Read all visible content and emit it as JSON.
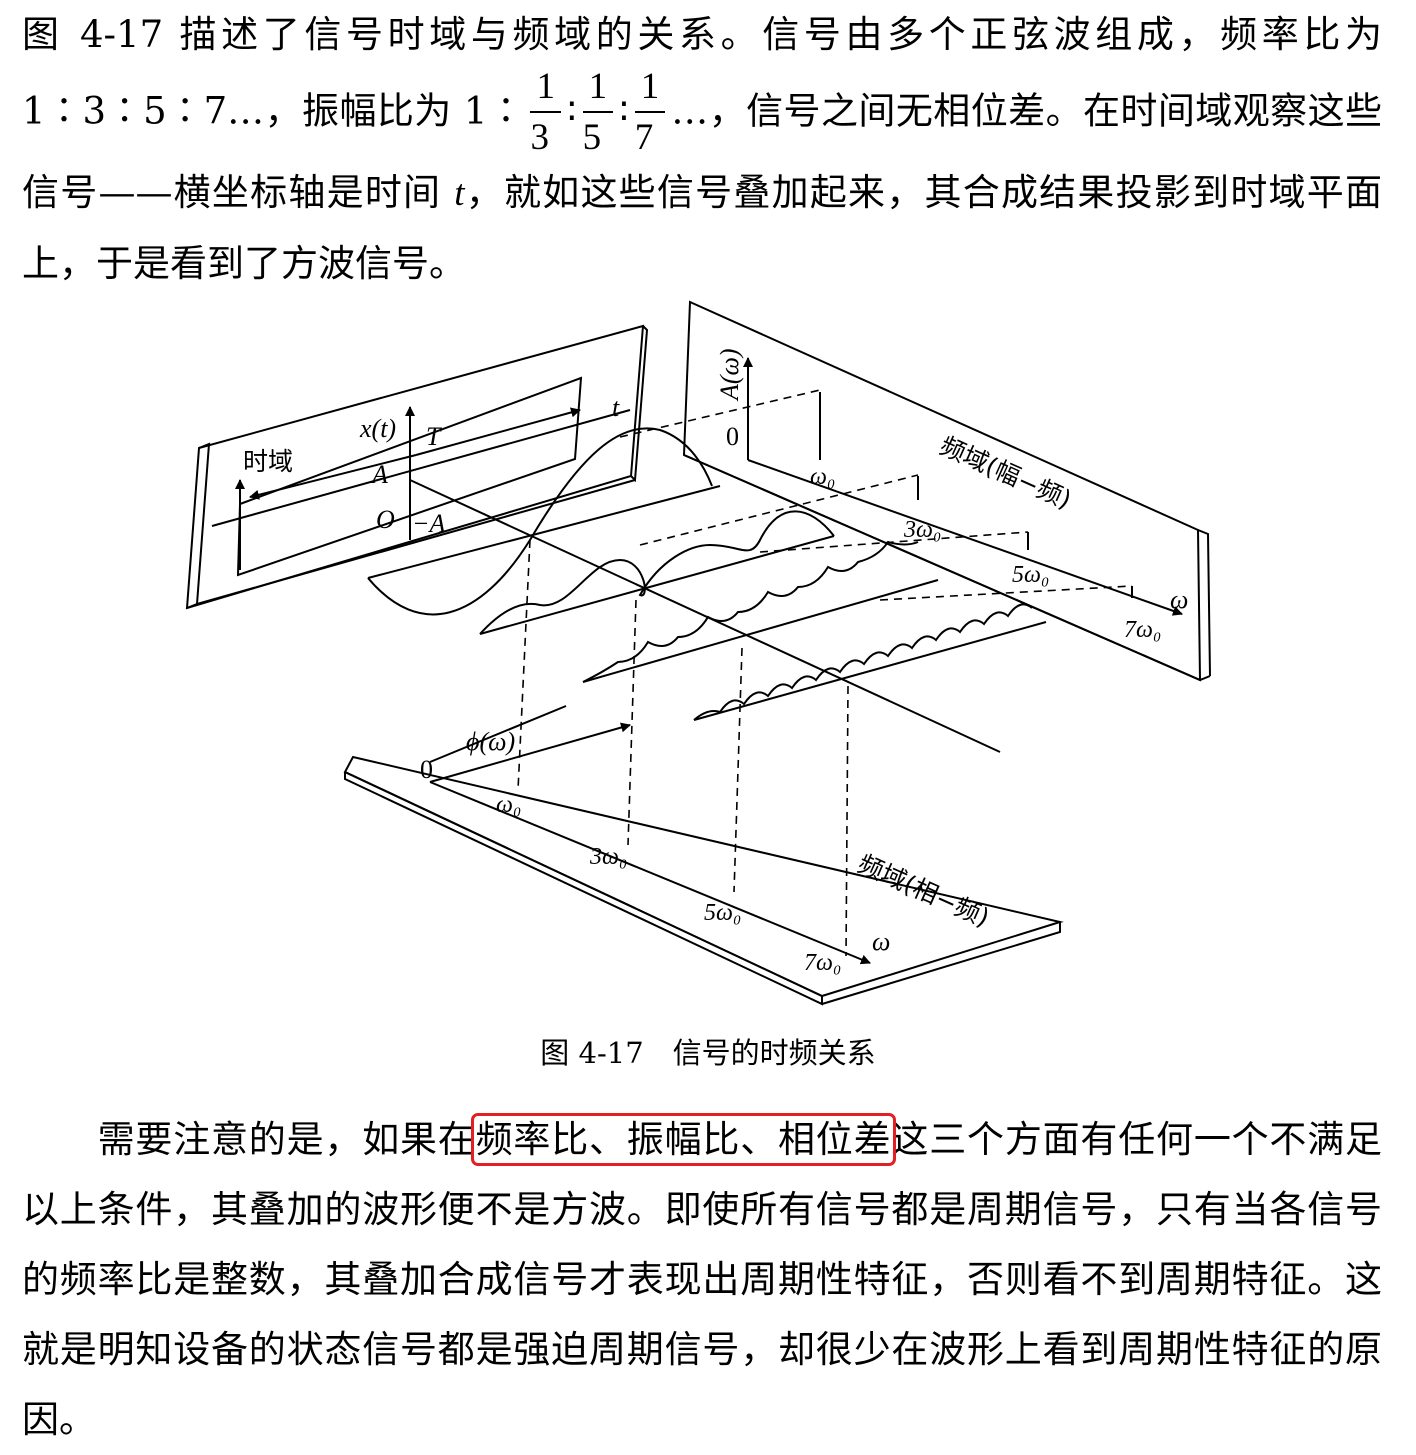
{
  "paragraph1": {
    "seg1": "图 4-17 描述了信号时域与频域的关系。信号由多个正弦波组成，频率比为 1∶3∶5∶7…，振幅比为 1∶",
    "frac1": {
      "num": "1",
      "den": "3"
    },
    "sep1": "∶",
    "frac2": {
      "num": "1",
      "den": "5"
    },
    "sep2": "∶",
    "frac3": {
      "num": "1",
      "den": "7"
    },
    "seg2": "…，信号之间无相位差。在时间域观察这些信号——横坐标轴是时间 ",
    "var_t": "t",
    "seg3": "，就如这些信号叠加起来，其合成结果投影到时域平面上，于是看到了方波信号。"
  },
  "figure": {
    "time_domain_label": "时域",
    "xt_label": "x(t)",
    "T_label": "T",
    "t_label": "t",
    "A_label": "A",
    "O_label": "O",
    "negA_label": "−A",
    "amp_label": "A(ω)",
    "zero_label": "0",
    "freq_amp_label": "频域(幅−频)",
    "freq_phase_label": "频域(相−频)",
    "phi_label": "ϕ(ω)",
    "omega_label": "ω",
    "w0": "ω₀",
    "w3": "3ω₀",
    "w5": "5ω₀",
    "w7": "7ω₀"
  },
  "caption": {
    "number": "图 4-17",
    "title": "信号的时频关系"
  },
  "paragraph2": {
    "before": "需要注意的是，如果在",
    "highlight": "频率比、振幅比、相位差",
    "after": "这三个方面有任何一个不满足以上条件，其叠加的波形便不是方波。即使所有信号都是周期信号，只有当各信号的频率比是整数，其叠加合成信号才表现出周期性特征，否则看不到周期特征。这就是明知设备的状态信号都是强迫周期信号，却很少在波形上看到周期性特征的原因。"
  }
}
